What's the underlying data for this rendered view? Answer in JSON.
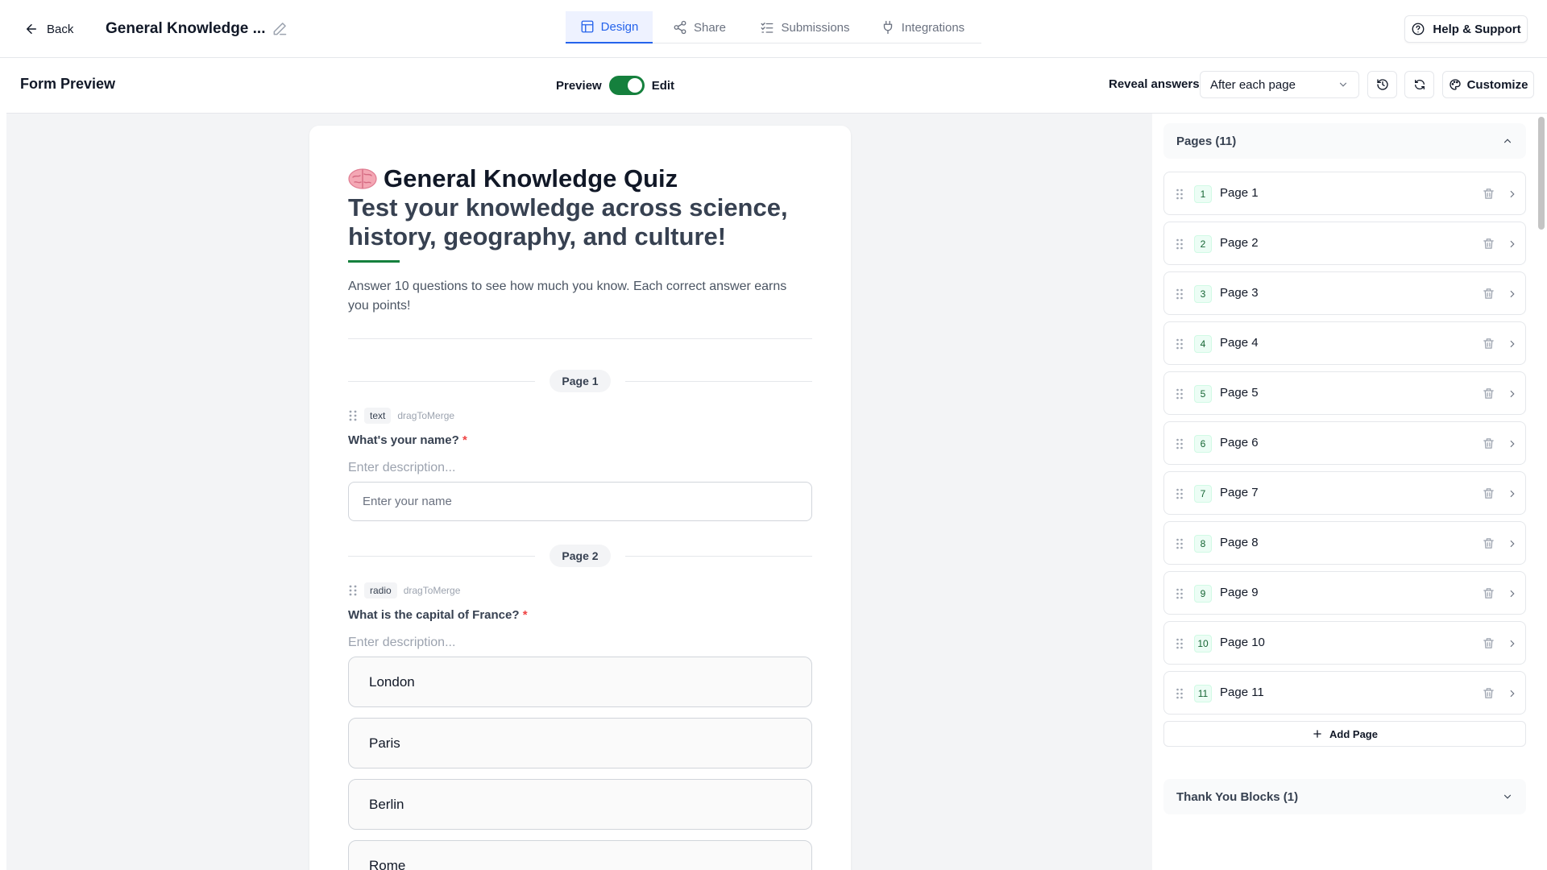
{
  "topbar": {
    "back_label": "Back",
    "form_title": "General Knowledge ...",
    "tabs": [
      {
        "label": "Design",
        "icon": "layout-icon",
        "active": true
      },
      {
        "label": "Share",
        "icon": "share-icon"
      },
      {
        "label": "Submissions",
        "icon": "list-checks-icon"
      },
      {
        "label": "Integrations",
        "icon": "plug-icon"
      }
    ],
    "help_label": "Help & Support"
  },
  "subbar": {
    "title": "Form Preview",
    "preview_label": "Preview",
    "edit_label": "Edit",
    "toggle_on": true,
    "reveal_label": "Reveal answers",
    "reveal_value": "After each page",
    "customize_label": "Customize"
  },
  "form": {
    "title": "General Knowledge Quiz",
    "subtitle": "Test your knowledge across science, history, geography, and culture!",
    "intro": "Answer 10 questions to see how much you know. Each correct answer earns you points!",
    "accent_color": "#15803d",
    "page1_label": "Page 1",
    "page2_label": "Page 2",
    "q1": {
      "type": "text",
      "merge": "dragToMerge",
      "label": "What's your name?",
      "required_mark": "*",
      "description_placeholder": "Enter description...",
      "input_placeholder": "Enter your name"
    },
    "q2": {
      "type": "radio",
      "merge": "dragToMerge",
      "label": "What is the capital of France?",
      "required_mark": "*",
      "description_placeholder": "Enter description...",
      "options": [
        "London",
        "Paris",
        "Berlin",
        "Rome"
      ]
    }
  },
  "sidebar": {
    "pages_header": "Pages (11)",
    "pages": [
      {
        "num": "1",
        "label": "Page 1"
      },
      {
        "num": "2",
        "label": "Page 2"
      },
      {
        "num": "3",
        "label": "Page 3"
      },
      {
        "num": "4",
        "label": "Page 4"
      },
      {
        "num": "5",
        "label": "Page 5"
      },
      {
        "num": "6",
        "label": "Page 6"
      },
      {
        "num": "7",
        "label": "Page 7"
      },
      {
        "num": "8",
        "label": "Page 8"
      },
      {
        "num": "9",
        "label": "Page 9"
      },
      {
        "num": "10",
        "label": "Page 10"
      },
      {
        "num": "11",
        "label": "Page 11"
      }
    ],
    "add_page_label": "Add Page",
    "thankyou_header": "Thank You Blocks (1)"
  }
}
